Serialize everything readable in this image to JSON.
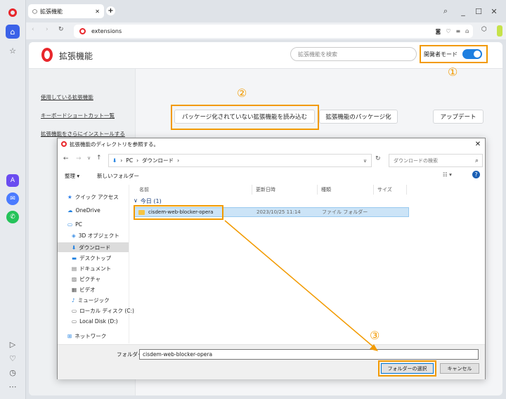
{
  "browser": {
    "tab_title": "拡張機能",
    "url": "extensions"
  },
  "page": {
    "title": "拡張機能",
    "search_placeholder": "拡張機能を検索",
    "dev_mode_label": "開発者モード",
    "dev_mode_on": true,
    "sidebar_links": [
      "使用している拡張機能",
      "キーボードショートカット一覧",
      "拡張機能をさらにインストールする"
    ],
    "buttons": {
      "load_unpacked": "パッケージ化されていない拡張機能を読み込む",
      "pack": "拡張機能のパッケージ化",
      "update": "アップデート"
    }
  },
  "annotations": {
    "step1": "①",
    "step2": "②",
    "step3": "③"
  },
  "dialog": {
    "title": "拡張機能のディレクトリを参照する。",
    "breadcrumb": [
      "PC",
      "ダウンロード"
    ],
    "search_placeholder": "ダウンロードの検索",
    "toolbar": {
      "organize": "整理 ▾",
      "new_folder": "新しいフォルダー"
    },
    "tree": {
      "quick_access": "クイック アクセス",
      "onedrive": "OneDrive",
      "pc": "PC",
      "objects3d": "3D オブジェクト",
      "downloads": "ダウンロード",
      "desktop": "デスクトップ",
      "documents": "ドキュメント",
      "pictures": "ピクチャ",
      "videos": "ビデオ",
      "music": "ミュージック",
      "local_disk_c": "ローカル ディスク (C:)",
      "local_disk_d": "Local Disk (D:)",
      "network": "ネットワーク"
    },
    "columns": {
      "name": "名前",
      "modified": "更新日時",
      "type": "種類",
      "size": "サイズ"
    },
    "group_label": "今日 (1)",
    "rows": [
      {
        "name": "cisdem-web-blocker-opera",
        "modified": "2023/10/25 11:14",
        "type": "ファイル フォルダー"
      }
    ],
    "folder_label": "フォルダー:",
    "folder_value": "cisdem-web-blocker-opera",
    "select_button": "フォルダーの選択",
    "cancel_button": "キャンセル"
  },
  "colors": {
    "accent": "#f29a00",
    "opera_red": "#e8262b",
    "toggle": "#1e7fe0",
    "selection": "#cce4f7"
  }
}
